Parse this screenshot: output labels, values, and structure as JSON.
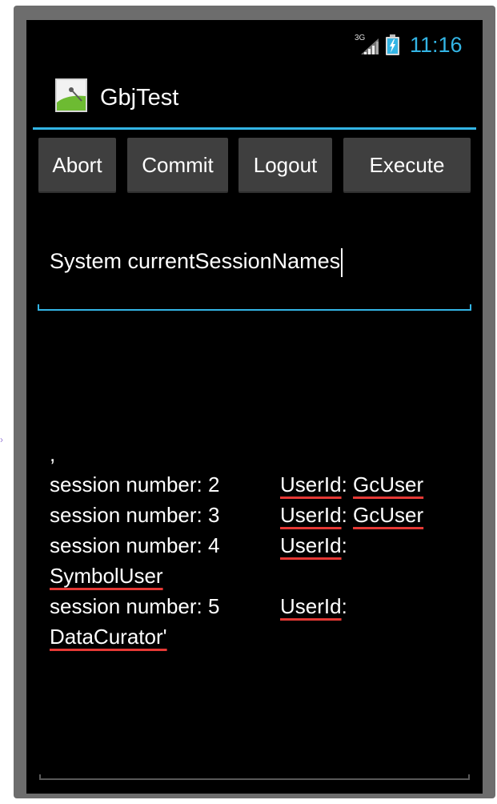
{
  "status_bar": {
    "network": "3G",
    "time": "11:16",
    "signal_icon": "signal-icon",
    "battery_icon": "battery-charging-icon",
    "time_color": "#33b5e5"
  },
  "action_bar": {
    "title": "GbjTest",
    "icon": "android-app-icon"
  },
  "buttons": [
    {
      "label": "Abort"
    },
    {
      "label": "Commit"
    },
    {
      "label": "Logout"
    },
    {
      "label": "Execute"
    }
  ],
  "input": {
    "value": "System currentSessionNames"
  },
  "output": {
    "prefix": ",",
    "lines": [
      {
        "label": "session number: 2",
        "field": "UserId",
        "value": "GcUser"
      },
      {
        "label": "session number: 3",
        "field": "UserId",
        "value": "GcUser"
      },
      {
        "label": "session number: 4",
        "field": "UserId",
        "value": "SymbolUser"
      },
      {
        "label": "session number: 5",
        "field": "UserId",
        "value": "DataCurator'"
      }
    ]
  },
  "colors": {
    "accent": "#33b5e5",
    "spellcheck": "#e53935",
    "button": "#3f3f3f",
    "background": "#000000"
  }
}
